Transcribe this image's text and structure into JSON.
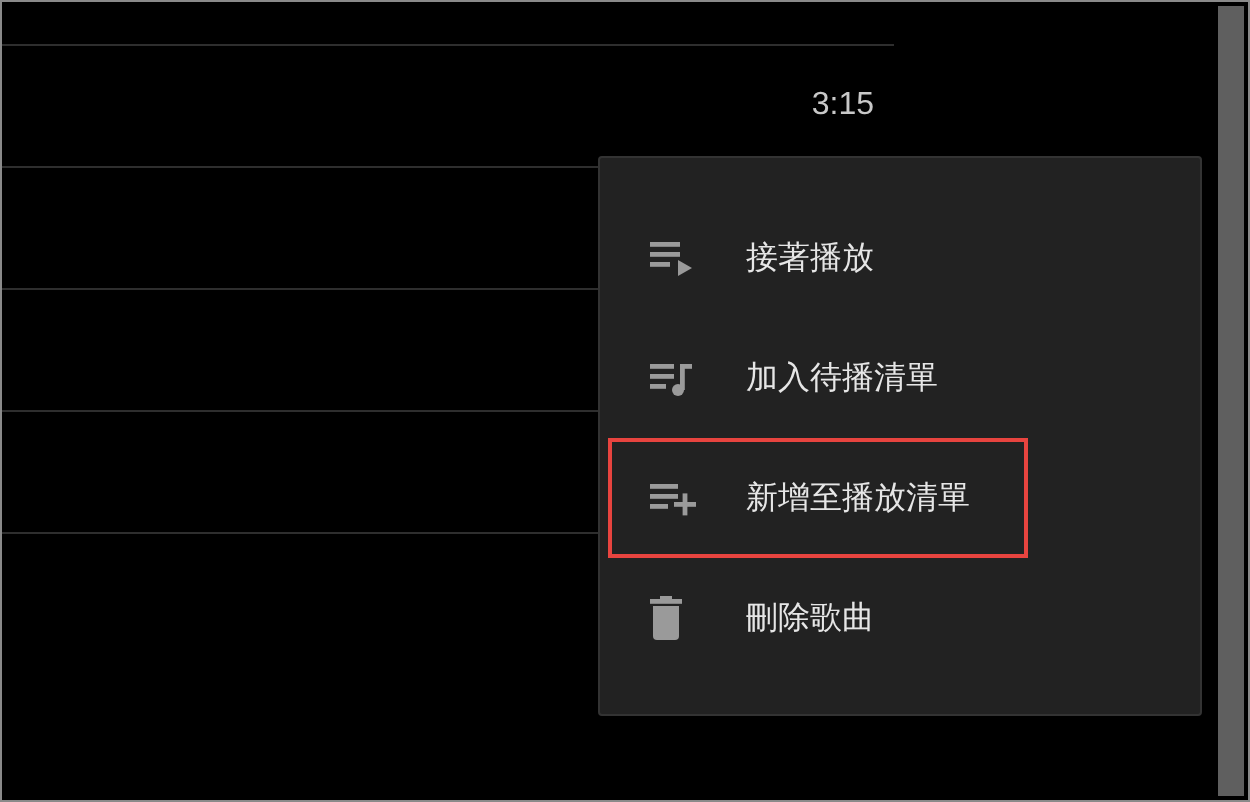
{
  "track_rows": [
    {
      "duration": "3:15"
    },
    {},
    {},
    {}
  ],
  "context_menu": {
    "items": [
      {
        "label": "接著播放",
        "kind": "play-next",
        "highlighted": false
      },
      {
        "label": "加入待播清單",
        "kind": "queue",
        "highlighted": false
      },
      {
        "label": "新增至播放清單",
        "kind": "add-playlist",
        "highlighted": true
      },
      {
        "label": "刪除歌曲",
        "kind": "delete",
        "highlighted": false
      }
    ]
  }
}
